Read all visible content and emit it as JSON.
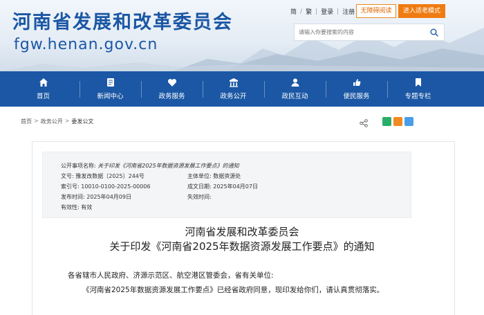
{
  "header": {
    "title": "河南省发展和改革委员会",
    "url": "fgw.henan.gov.cn",
    "links": {
      "simplified": "简",
      "traditional": "繁",
      "login": "登录",
      "register": "注册"
    },
    "accessible_label": "无障碍阅读",
    "elder_mode_label": "进入适老模式",
    "search_placeholder": "请输入你要搜索的内容"
  },
  "nav": {
    "items": [
      {
        "label": "首页",
        "icon": "home-icon"
      },
      {
        "label": "新闻中心",
        "icon": "news-icon"
      },
      {
        "label": "政务服务",
        "icon": "service-icon"
      },
      {
        "label": "政务公开",
        "icon": "open-icon"
      },
      {
        "label": "政民互动",
        "icon": "interaction-icon"
      },
      {
        "label": "便民服务",
        "icon": "convenience-icon"
      },
      {
        "label": "专题专栏",
        "icon": "topic-icon"
      }
    ]
  },
  "breadcrumb": {
    "items": [
      "首页",
      "政务公开",
      "委发公文"
    ],
    "separator": ">"
  },
  "meta": {
    "item_name_label": "公开事项名称:",
    "item_name_value": "关于印发《河南省2025年数据资源发展工作要点》的通知",
    "doc_no_label": "文号:",
    "doc_no_value": "豫发改数据〔2025〕244号",
    "dept_label": "主体单位:",
    "dept_value": "数据资源处",
    "index_label": "索引号:",
    "index_value": "10010-0100-2025-00006",
    "created_label": "成文日期:",
    "created_value": "2025年04月07日",
    "published_label": "发布时间:",
    "published_value": "2025年04月09日",
    "expiry_label": "失效时间:",
    "expiry_value": "",
    "validity_label": "有效性:",
    "validity_value": "有效"
  },
  "document": {
    "issuer": "河南省发展和改革委员会",
    "title": "关于印发《河南省2025年数据资源发展工作要点》的通知",
    "salutation": "各省辖市人民政府、济源示范区、航空港区管委会，省有关单位:",
    "paragraph1": "《河南省2025年数据资源发展工作要点》已经省政府同意，现印发给你们，请认真贯彻落实。"
  },
  "colors": {
    "brand_blue": "#1b57a4",
    "accent_orange": "#ef7b11",
    "wechat_green": "#2aae67",
    "weibo_orange": "#f08a24",
    "qzone_blue": "#4a9ee8"
  }
}
